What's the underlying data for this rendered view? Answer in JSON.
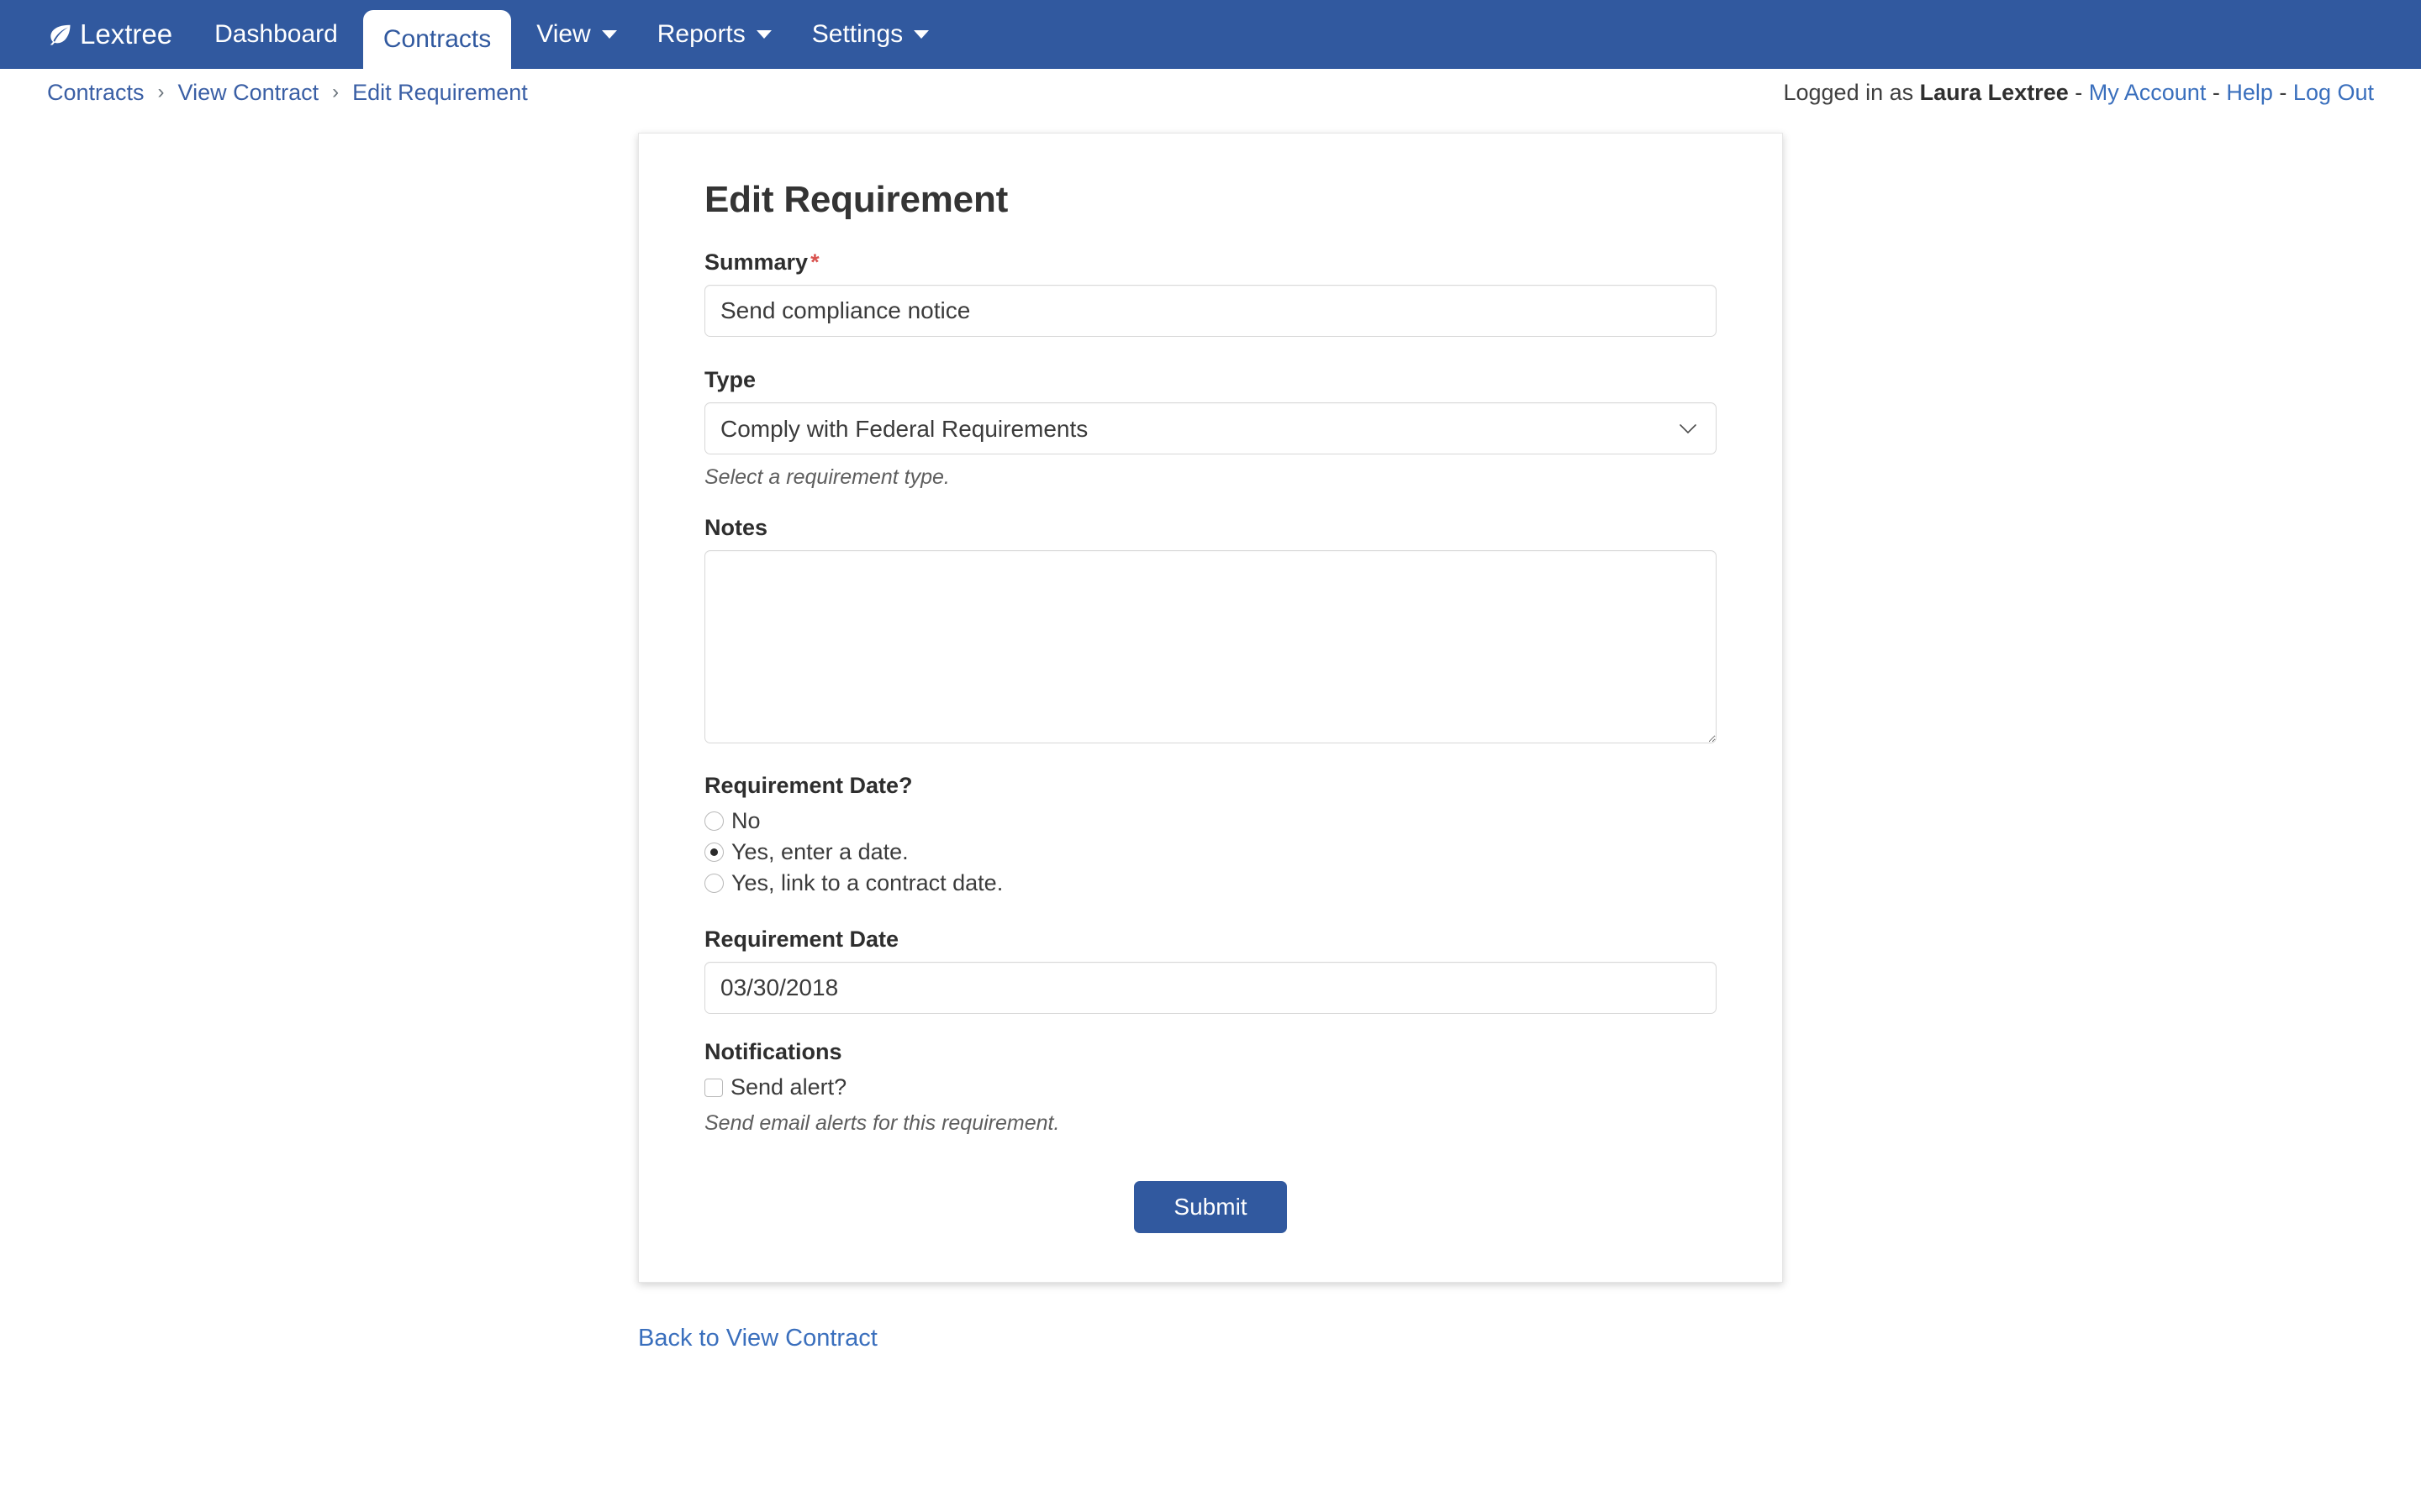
{
  "navbar": {
    "brand": {
      "label": "Lextree",
      "icon": "leaf-icon"
    },
    "items": [
      {
        "label": "Dashboard",
        "active": false,
        "has_caret": false
      },
      {
        "label": "Contracts",
        "active": true,
        "has_caret": false
      },
      {
        "label": "View",
        "active": false,
        "has_caret": true
      },
      {
        "label": "Reports",
        "active": false,
        "has_caret": true
      },
      {
        "label": "Settings",
        "active": false,
        "has_caret": true
      }
    ],
    "background_color": "#31599f",
    "active_text_color": "#31599f"
  },
  "breadcrumb": {
    "separator": "›",
    "items": [
      {
        "label": "Contracts"
      },
      {
        "label": "View Contract"
      },
      {
        "label": "Edit Requirement"
      }
    ]
  },
  "userbar": {
    "prefix": "Logged in as",
    "user_name": "Laura Lextree",
    "separator": "-",
    "links": [
      {
        "label": "My Account"
      },
      {
        "label": "Help"
      },
      {
        "label": "Log Out"
      }
    ]
  },
  "form": {
    "title": "Edit Requirement",
    "summary": {
      "label": "Summary",
      "required_marker": "*",
      "value": "Send compliance notice",
      "placeholder": ""
    },
    "type": {
      "label": "Type",
      "value": "Comply with Federal Requirements",
      "help": "Select a requirement type.",
      "options": [
        "Comply with Federal Requirements"
      ],
      "chevron_icon": "chevron-down-icon"
    },
    "notes": {
      "label": "Notes",
      "value": "",
      "placeholder": ""
    },
    "requirement_date_question": {
      "label": "Requirement Date?",
      "options": [
        {
          "label": "No",
          "selected": false
        },
        {
          "label": "Yes, enter a date.",
          "selected": true
        },
        {
          "label": "Yes, link to a contract date.",
          "selected": false
        }
      ]
    },
    "requirement_date": {
      "label": "Requirement Date",
      "value": "03/30/2018",
      "placeholder": ""
    },
    "notifications": {
      "label": "Notifications",
      "checkbox_label": "Send alert?",
      "checked": false,
      "help": "Send email alerts for this requirement."
    },
    "submit": {
      "label": "Submit",
      "background_color": "#31599f"
    }
  },
  "footer": {
    "back_link": "Back to View Contract",
    "link_color": "#3a6fbd"
  }
}
